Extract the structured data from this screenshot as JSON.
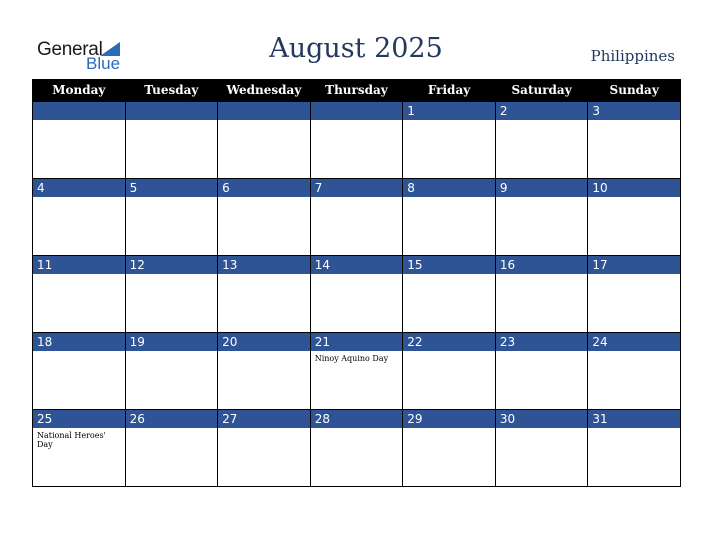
{
  "logo": {
    "general": "General",
    "blue": "Blue"
  },
  "header": {
    "title": "August 2025",
    "country": "Philippines"
  },
  "colors": {
    "accent": "#2f5496",
    "header_bg": "#000000",
    "title": "#24395f"
  },
  "weekdays": [
    "Monday",
    "Tuesday",
    "Wednesday",
    "Thursday",
    "Friday",
    "Saturday",
    "Sunday"
  ],
  "weeks": [
    [
      {
        "day": "",
        "event": ""
      },
      {
        "day": "",
        "event": ""
      },
      {
        "day": "",
        "event": ""
      },
      {
        "day": "",
        "event": ""
      },
      {
        "day": "1",
        "event": ""
      },
      {
        "day": "2",
        "event": ""
      },
      {
        "day": "3",
        "event": ""
      }
    ],
    [
      {
        "day": "4",
        "event": ""
      },
      {
        "day": "5",
        "event": ""
      },
      {
        "day": "6",
        "event": ""
      },
      {
        "day": "7",
        "event": ""
      },
      {
        "day": "8",
        "event": ""
      },
      {
        "day": "9",
        "event": ""
      },
      {
        "day": "10",
        "event": ""
      }
    ],
    [
      {
        "day": "11",
        "event": ""
      },
      {
        "day": "12",
        "event": ""
      },
      {
        "day": "13",
        "event": ""
      },
      {
        "day": "14",
        "event": ""
      },
      {
        "day": "15",
        "event": ""
      },
      {
        "day": "16",
        "event": ""
      },
      {
        "day": "17",
        "event": ""
      }
    ],
    [
      {
        "day": "18",
        "event": ""
      },
      {
        "day": "19",
        "event": ""
      },
      {
        "day": "20",
        "event": ""
      },
      {
        "day": "21",
        "event": "Ninoy Aquino Day"
      },
      {
        "day": "22",
        "event": ""
      },
      {
        "day": "23",
        "event": ""
      },
      {
        "day": "24",
        "event": ""
      }
    ],
    [
      {
        "day": "25",
        "event": "National Heroes' Day"
      },
      {
        "day": "26",
        "event": ""
      },
      {
        "day": "27",
        "event": ""
      },
      {
        "day": "28",
        "event": ""
      },
      {
        "day": "29",
        "event": ""
      },
      {
        "day": "30",
        "event": ""
      },
      {
        "day": "31",
        "event": ""
      }
    ]
  ]
}
